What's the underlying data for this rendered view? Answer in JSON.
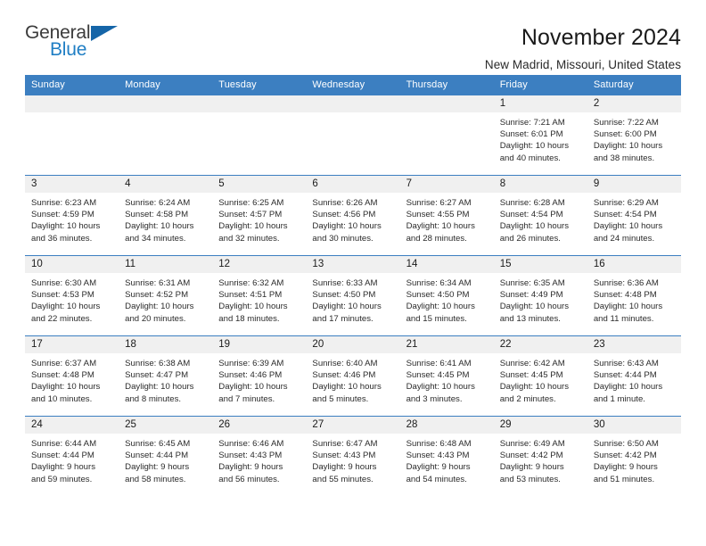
{
  "logo": {
    "word_top": "General",
    "word_bottom": "Blue",
    "triangle": "blue-triangle-icon",
    "color_dark": "#3b3b3b",
    "color_blue": "#1f7ec4"
  },
  "header": {
    "title": "November 2024",
    "subtitle": "New Madrid, Missouri, United States"
  },
  "theme": {
    "header_bg": "#3c7fc1",
    "daynum_bg": "#f0f0f0",
    "row_border": "#3c7fc1"
  },
  "weekday_headers": [
    "Sunday",
    "Monday",
    "Tuesday",
    "Wednesday",
    "Thursday",
    "Friday",
    "Saturday"
  ],
  "labels": {
    "sunrise_prefix": "Sunrise:",
    "sunset_prefix": "Sunset:",
    "daylight_prefix": "Daylight:"
  },
  "weeks": [
    [
      {
        "day": "",
        "empty": true
      },
      {
        "day": "",
        "empty": true
      },
      {
        "day": "",
        "empty": true
      },
      {
        "day": "",
        "empty": true
      },
      {
        "day": "",
        "empty": true
      },
      {
        "day": "1",
        "sunrise": "Sunrise: 7:21 AM",
        "sunset": "Sunset: 6:01 PM",
        "daylight_line1": "Daylight: 10 hours",
        "daylight_line2": "and 40 minutes."
      },
      {
        "day": "2",
        "sunrise": "Sunrise: 7:22 AM",
        "sunset": "Sunset: 6:00 PM",
        "daylight_line1": "Daylight: 10 hours",
        "daylight_line2": "and 38 minutes."
      }
    ],
    [
      {
        "day": "3",
        "sunrise": "Sunrise: 6:23 AM",
        "sunset": "Sunset: 4:59 PM",
        "daylight_line1": "Daylight: 10 hours",
        "daylight_line2": "and 36 minutes."
      },
      {
        "day": "4",
        "sunrise": "Sunrise: 6:24 AM",
        "sunset": "Sunset: 4:58 PM",
        "daylight_line1": "Daylight: 10 hours",
        "daylight_line2": "and 34 minutes."
      },
      {
        "day": "5",
        "sunrise": "Sunrise: 6:25 AM",
        "sunset": "Sunset: 4:57 PM",
        "daylight_line1": "Daylight: 10 hours",
        "daylight_line2": "and 32 minutes."
      },
      {
        "day": "6",
        "sunrise": "Sunrise: 6:26 AM",
        "sunset": "Sunset: 4:56 PM",
        "daylight_line1": "Daylight: 10 hours",
        "daylight_line2": "and 30 minutes."
      },
      {
        "day": "7",
        "sunrise": "Sunrise: 6:27 AM",
        "sunset": "Sunset: 4:55 PM",
        "daylight_line1": "Daylight: 10 hours",
        "daylight_line2": "and 28 minutes."
      },
      {
        "day": "8",
        "sunrise": "Sunrise: 6:28 AM",
        "sunset": "Sunset: 4:54 PM",
        "daylight_line1": "Daylight: 10 hours",
        "daylight_line2": "and 26 minutes."
      },
      {
        "day": "9",
        "sunrise": "Sunrise: 6:29 AM",
        "sunset": "Sunset: 4:54 PM",
        "daylight_line1": "Daylight: 10 hours",
        "daylight_line2": "and 24 minutes."
      }
    ],
    [
      {
        "day": "10",
        "sunrise": "Sunrise: 6:30 AM",
        "sunset": "Sunset: 4:53 PM",
        "daylight_line1": "Daylight: 10 hours",
        "daylight_line2": "and 22 minutes."
      },
      {
        "day": "11",
        "sunrise": "Sunrise: 6:31 AM",
        "sunset": "Sunset: 4:52 PM",
        "daylight_line1": "Daylight: 10 hours",
        "daylight_line2": "and 20 minutes."
      },
      {
        "day": "12",
        "sunrise": "Sunrise: 6:32 AM",
        "sunset": "Sunset: 4:51 PM",
        "daylight_line1": "Daylight: 10 hours",
        "daylight_line2": "and 18 minutes."
      },
      {
        "day": "13",
        "sunrise": "Sunrise: 6:33 AM",
        "sunset": "Sunset: 4:50 PM",
        "daylight_line1": "Daylight: 10 hours",
        "daylight_line2": "and 17 minutes."
      },
      {
        "day": "14",
        "sunrise": "Sunrise: 6:34 AM",
        "sunset": "Sunset: 4:50 PM",
        "daylight_line1": "Daylight: 10 hours",
        "daylight_line2": "and 15 minutes."
      },
      {
        "day": "15",
        "sunrise": "Sunrise: 6:35 AM",
        "sunset": "Sunset: 4:49 PM",
        "daylight_line1": "Daylight: 10 hours",
        "daylight_line2": "and 13 minutes."
      },
      {
        "day": "16",
        "sunrise": "Sunrise: 6:36 AM",
        "sunset": "Sunset: 4:48 PM",
        "daylight_line1": "Daylight: 10 hours",
        "daylight_line2": "and 11 minutes."
      }
    ],
    [
      {
        "day": "17",
        "sunrise": "Sunrise: 6:37 AM",
        "sunset": "Sunset: 4:48 PM",
        "daylight_line1": "Daylight: 10 hours",
        "daylight_line2": "and 10 minutes."
      },
      {
        "day": "18",
        "sunrise": "Sunrise: 6:38 AM",
        "sunset": "Sunset: 4:47 PM",
        "daylight_line1": "Daylight: 10 hours",
        "daylight_line2": "and 8 minutes."
      },
      {
        "day": "19",
        "sunrise": "Sunrise: 6:39 AM",
        "sunset": "Sunset: 4:46 PM",
        "daylight_line1": "Daylight: 10 hours",
        "daylight_line2": "and 7 minutes."
      },
      {
        "day": "20",
        "sunrise": "Sunrise: 6:40 AM",
        "sunset": "Sunset: 4:46 PM",
        "daylight_line1": "Daylight: 10 hours",
        "daylight_line2": "and 5 minutes."
      },
      {
        "day": "21",
        "sunrise": "Sunrise: 6:41 AM",
        "sunset": "Sunset: 4:45 PM",
        "daylight_line1": "Daylight: 10 hours",
        "daylight_line2": "and 3 minutes."
      },
      {
        "day": "22",
        "sunrise": "Sunrise: 6:42 AM",
        "sunset": "Sunset: 4:45 PM",
        "daylight_line1": "Daylight: 10 hours",
        "daylight_line2": "and 2 minutes."
      },
      {
        "day": "23",
        "sunrise": "Sunrise: 6:43 AM",
        "sunset": "Sunset: 4:44 PM",
        "daylight_line1": "Daylight: 10 hours",
        "daylight_line2": "and 1 minute."
      }
    ],
    [
      {
        "day": "24",
        "sunrise": "Sunrise: 6:44 AM",
        "sunset": "Sunset: 4:44 PM",
        "daylight_line1": "Daylight: 9 hours",
        "daylight_line2": "and 59 minutes."
      },
      {
        "day": "25",
        "sunrise": "Sunrise: 6:45 AM",
        "sunset": "Sunset: 4:44 PM",
        "daylight_line1": "Daylight: 9 hours",
        "daylight_line2": "and 58 minutes."
      },
      {
        "day": "26",
        "sunrise": "Sunrise: 6:46 AM",
        "sunset": "Sunset: 4:43 PM",
        "daylight_line1": "Daylight: 9 hours",
        "daylight_line2": "and 56 minutes."
      },
      {
        "day": "27",
        "sunrise": "Sunrise: 6:47 AM",
        "sunset": "Sunset: 4:43 PM",
        "daylight_line1": "Daylight: 9 hours",
        "daylight_line2": "and 55 minutes."
      },
      {
        "day": "28",
        "sunrise": "Sunrise: 6:48 AM",
        "sunset": "Sunset: 4:43 PM",
        "daylight_line1": "Daylight: 9 hours",
        "daylight_line2": "and 54 minutes."
      },
      {
        "day": "29",
        "sunrise": "Sunrise: 6:49 AM",
        "sunset": "Sunset: 4:42 PM",
        "daylight_line1": "Daylight: 9 hours",
        "daylight_line2": "and 53 minutes."
      },
      {
        "day": "30",
        "sunrise": "Sunrise: 6:50 AM",
        "sunset": "Sunset: 4:42 PM",
        "daylight_line1": "Daylight: 9 hours",
        "daylight_line2": "and 51 minutes."
      }
    ]
  ]
}
